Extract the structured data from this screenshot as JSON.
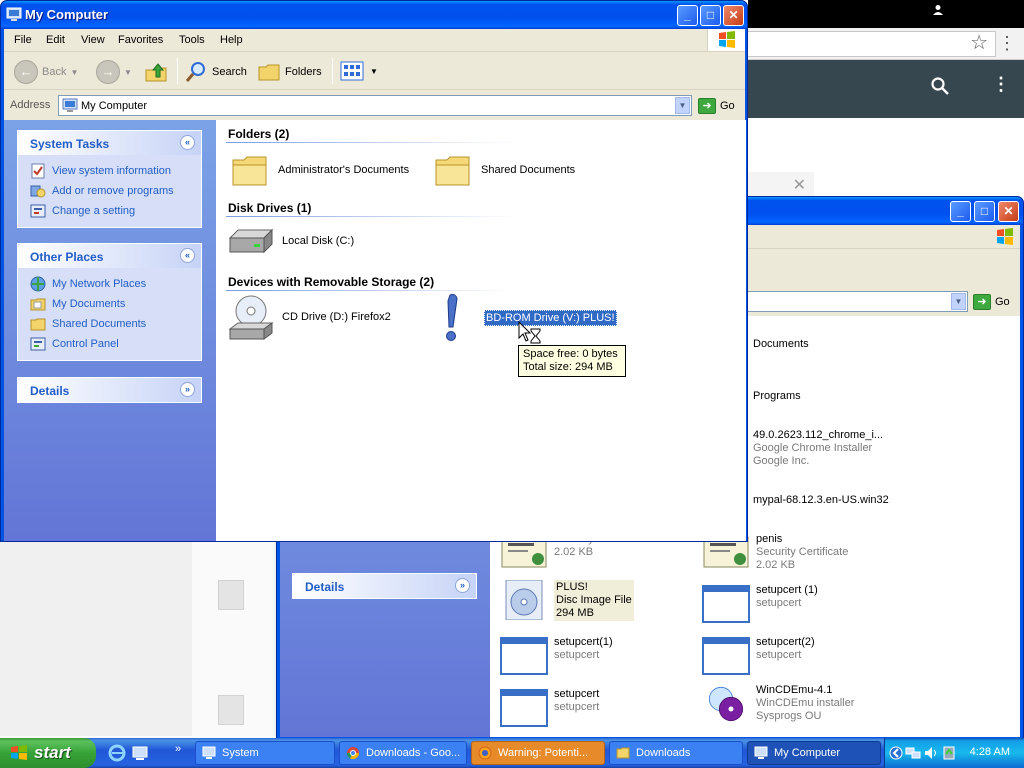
{
  "background_browser": {
    "snackbar_close": "✕"
  },
  "main_window": {
    "title": "My Computer",
    "menu": [
      "File",
      "Edit",
      "View",
      "Favorites",
      "Tools",
      "Help"
    ],
    "toolbar": {
      "back": "Back",
      "search": "Search",
      "folders": "Folders"
    },
    "address": {
      "label": "Address",
      "value": "My Computer",
      "go": "Go"
    },
    "panels": [
      {
        "title": "System Tasks",
        "items": [
          "View system information",
          "Add or remove programs",
          "Change a setting"
        ]
      },
      {
        "title": "Other Places",
        "items": [
          "My Network Places",
          "My Documents",
          "Shared Documents",
          "Control Panel"
        ]
      },
      {
        "title": "Details",
        "items": []
      }
    ],
    "groups": [
      {
        "title": "Folders (2)",
        "items": [
          "Administrator's Documents",
          "Shared Documents"
        ]
      },
      {
        "title": "Disk Drives (1)",
        "items": [
          "Local Disk (C:)"
        ]
      },
      {
        "title": "Devices with Removable Storage (2)",
        "items": [
          "CD Drive (D:) Firefox2",
          "BD-ROM Drive (V:) PLUS!"
        ]
      }
    ],
    "tooltip": {
      "line1": "Space free: 0 bytes",
      "line2": "Total size: 294 MB"
    }
  },
  "downloads_window": {
    "address_go": "Go",
    "details_panel": "Details",
    "items": [
      {
        "name": "Documents",
        "sub1": "",
        "sub2": ""
      },
      {
        "name": "Programs",
        "sub1": "",
        "sub2": ""
      },
      {
        "name": "49.0.2623.112_chrome_i...",
        "sub1": "Google Chrome Installer",
        "sub2": "Google Inc."
      },
      {
        "name": "mypal-68.12.3.en-US.win32",
        "sub1": "",
        "sub2": ""
      },
      {
        "name": "",
        "sub1": "Security Certificate",
        "sub2": "2.02 KB"
      },
      {
        "name": "penis",
        "sub1": "Security Certificate",
        "sub2": "2.02 KB"
      },
      {
        "name": "PLUS!",
        "sub1": "Disc Image File",
        "sub2": "294 MB"
      },
      {
        "name": "setupcert (1)",
        "sub1": "setupcert",
        "sub2": ""
      },
      {
        "name": "setupcert(1)",
        "sub1": "setupcert",
        "sub2": ""
      },
      {
        "name": "setupcert(2)",
        "sub1": "setupcert",
        "sub2": ""
      },
      {
        "name": "setupcert",
        "sub1": "setupcert",
        "sub2": ""
      },
      {
        "name": "WinCDEmu-4.1",
        "sub1": "WinCDEmu installer",
        "sub2": "Sysprogs OU"
      }
    ]
  },
  "taskbar": {
    "start": "start",
    "tasks": [
      "System",
      "Downloads - Goo...",
      "Warning: Potenti...",
      "Downloads",
      "My Computer"
    ],
    "clock": "4:28 AM"
  },
  "colors": {
    "xp_blue": "#0054e3",
    "task_link": "#215dc6",
    "selection": "#316ac5"
  }
}
